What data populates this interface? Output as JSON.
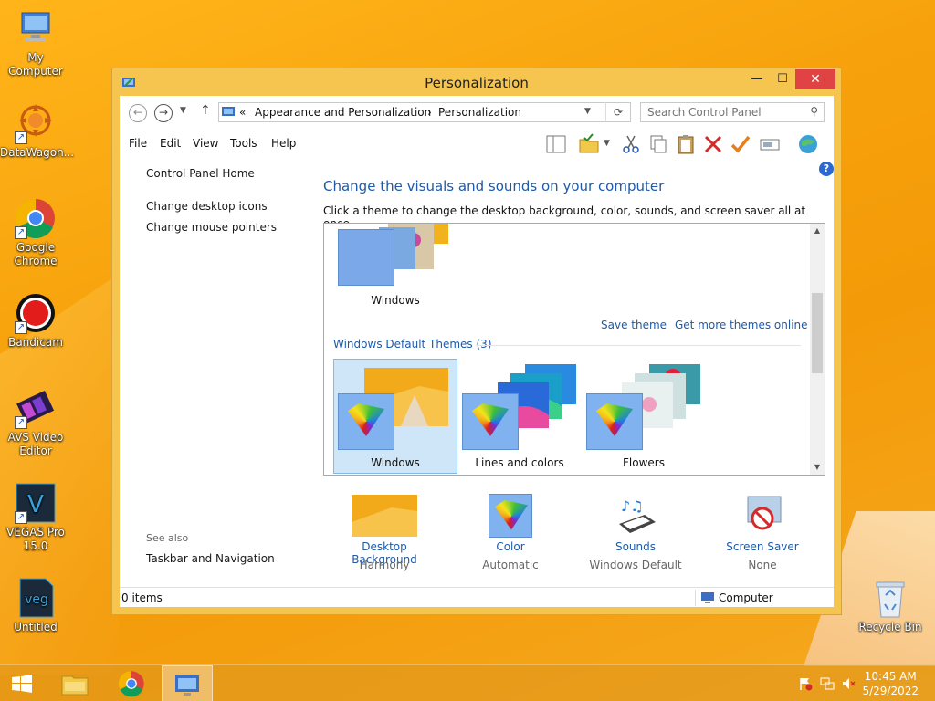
{
  "desktop": {
    "icons": [
      {
        "label": "My Computer"
      },
      {
        "label": "DataWagon..."
      },
      {
        "label": "Google Chrome"
      },
      {
        "label": "Bandicam"
      },
      {
        "label": "AVS Video Editor"
      },
      {
        "label": "VEGAS Pro 15.0"
      },
      {
        "label": "Untitled"
      },
      {
        "label": "Recycle Bin"
      }
    ]
  },
  "window": {
    "title": "Personalization",
    "controls": {
      "minimize": "—",
      "maximize": "☐",
      "close": "✕"
    },
    "address": {
      "prefix": "«",
      "crumbs": [
        "Appearance and Personalization",
        "Personalization"
      ],
      "separator": "›"
    },
    "search": {
      "placeholder": "Search Control Panel"
    },
    "menu": [
      "File",
      "Edit",
      "View",
      "Tools",
      "Help"
    ],
    "left_pane": {
      "home": "Control Panel Home",
      "links": [
        "Change desktop icons",
        "Change mouse pointers"
      ],
      "see_also_header": "See also",
      "see_also_links": [
        "Taskbar and Navigation"
      ]
    },
    "main": {
      "title": "Change the visuals and sounds on your computer",
      "subtitle": "Click a theme to change the desktop background, color, sounds, and screen saver all at once.",
      "my_themes": [
        {
          "label": "Windows"
        }
      ],
      "save_theme": "Save theme",
      "get_more": "Get more themes online",
      "default_group_header": "Windows Default Themes (3)",
      "default_themes": [
        {
          "label": "Windows",
          "selected": true
        },
        {
          "label": "Lines and colors",
          "selected": false
        },
        {
          "label": "Flowers",
          "selected": false
        }
      ]
    },
    "bottom_settings": [
      {
        "label": "Desktop Background",
        "value": "Harmony"
      },
      {
        "label": "Color",
        "value": "Automatic"
      },
      {
        "label": "Sounds",
        "value": "Windows Default"
      },
      {
        "label": "Screen Saver",
        "value": "None"
      }
    ],
    "status": {
      "items": "0 items",
      "location": "Computer"
    }
  },
  "taskbar": {
    "time": "10:45 AM",
    "date": "5/29/2022"
  },
  "colors": {
    "accent_blue": "#1e5aa8",
    "window_frame": "#f5c550",
    "close_red": "#e04343",
    "selection": "#cfe6f8"
  }
}
